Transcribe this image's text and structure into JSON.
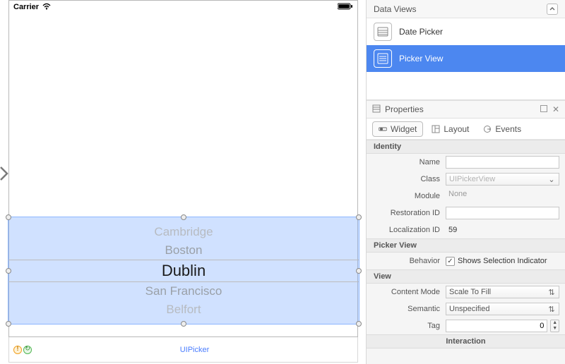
{
  "status_bar": {
    "carrier": "Carrier"
  },
  "picker": {
    "items": [
      "Cambridge",
      "Boston",
      "Dublin",
      "San Francisco",
      "Belfort"
    ],
    "selected_index": 2
  },
  "footer": {
    "label": "UIPicker"
  },
  "inspector": {
    "data_views": {
      "title": "Data Views",
      "items": [
        {
          "label": "Date Picker",
          "selected": false
        },
        {
          "label": "Picker View",
          "selected": true
        }
      ]
    },
    "properties_title": "Properties",
    "tabs": [
      {
        "label": "Widget",
        "active": true
      },
      {
        "label": "Layout",
        "active": false
      },
      {
        "label": "Events",
        "active": false
      }
    ],
    "sections": {
      "identity": {
        "title": "Identity",
        "name": "",
        "class": "UIPickerView",
        "module": "None",
        "restoration_id": "",
        "localization_id": "59"
      },
      "picker_view": {
        "title": "Picker View",
        "behavior_label": "Behavior",
        "shows_selection_indicator_label": "Shows Selection Indicator",
        "shows_selection_indicator": true
      },
      "view": {
        "title": "View",
        "content_mode": "Scale To Fill",
        "semantic": "Unspecified",
        "tag": "0"
      },
      "interaction": {
        "title": "Interaction"
      }
    },
    "labels": {
      "name": "Name",
      "class": "Class",
      "module": "Module",
      "restoration_id": "Restoration ID",
      "localization_id": "Localization ID",
      "content_mode": "Content Mode",
      "semantic": "Semantic",
      "tag": "Tag"
    }
  }
}
